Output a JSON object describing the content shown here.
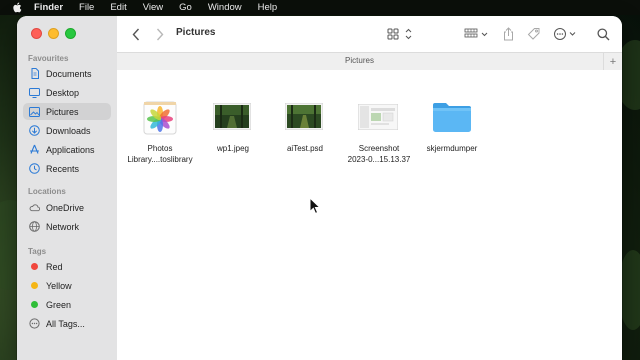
{
  "menubar": {
    "app": "Finder",
    "items": [
      "File",
      "Edit",
      "View",
      "Go",
      "Window",
      "Help"
    ]
  },
  "toolbar": {
    "title": "Pictures",
    "icons": [
      "back-chevron-icon",
      "forward-chevron-icon",
      "icon-view-grid-icon",
      "group-by-icon",
      "share-icon",
      "tag-icon",
      "more-actions-icon",
      "search-icon"
    ]
  },
  "tab": {
    "label": "Pictures",
    "add_label": "+"
  },
  "sidebar": {
    "favourites_heading": "Favourites",
    "favourites": [
      {
        "label": "Documents",
        "icon": "document-icon"
      },
      {
        "label": "Desktop",
        "icon": "desktop-icon"
      },
      {
        "label": "Pictures",
        "icon": "pictures-icon",
        "active": true
      },
      {
        "label": "Downloads",
        "icon": "download-icon"
      },
      {
        "label": "Applications",
        "icon": "applications-icon"
      },
      {
        "label": "Recents",
        "icon": "clock-icon"
      }
    ],
    "locations_heading": "Locations",
    "locations": [
      {
        "label": "OneDrive",
        "icon": "cloud-icon"
      },
      {
        "label": "Network",
        "icon": "globe-icon"
      }
    ],
    "tags_heading": "Tags",
    "tags": [
      {
        "label": "Red",
        "color": "#f0463c"
      },
      {
        "label": "Yellow",
        "color": "#f5b615"
      },
      {
        "label": "Green",
        "color": "#2fbe38"
      },
      {
        "label": "All Tags...",
        "icon": "all-tags-icon"
      }
    ]
  },
  "files": [
    {
      "line1": "Photos",
      "line2": "Library....toslibrary",
      "icon": "photos-library-icon"
    },
    {
      "line1": "wp1.jpeg",
      "line2": "",
      "icon": "forest-image-thumbnail"
    },
    {
      "line1": "aiTest.psd",
      "line2": "",
      "icon": "forest-image-thumbnail"
    },
    {
      "line1": "Screenshot",
      "line2": "2023-0...15.13.37",
      "icon": "screenshot-thumbnail"
    },
    {
      "line1": "skjermdumper",
      "line2": "",
      "icon": "folder-icon"
    }
  ],
  "colors": {
    "sidebar_bg": "#e3e3e4",
    "folder_blue": "#4fb1f0",
    "menubar_bg": "#0b0f0a"
  }
}
